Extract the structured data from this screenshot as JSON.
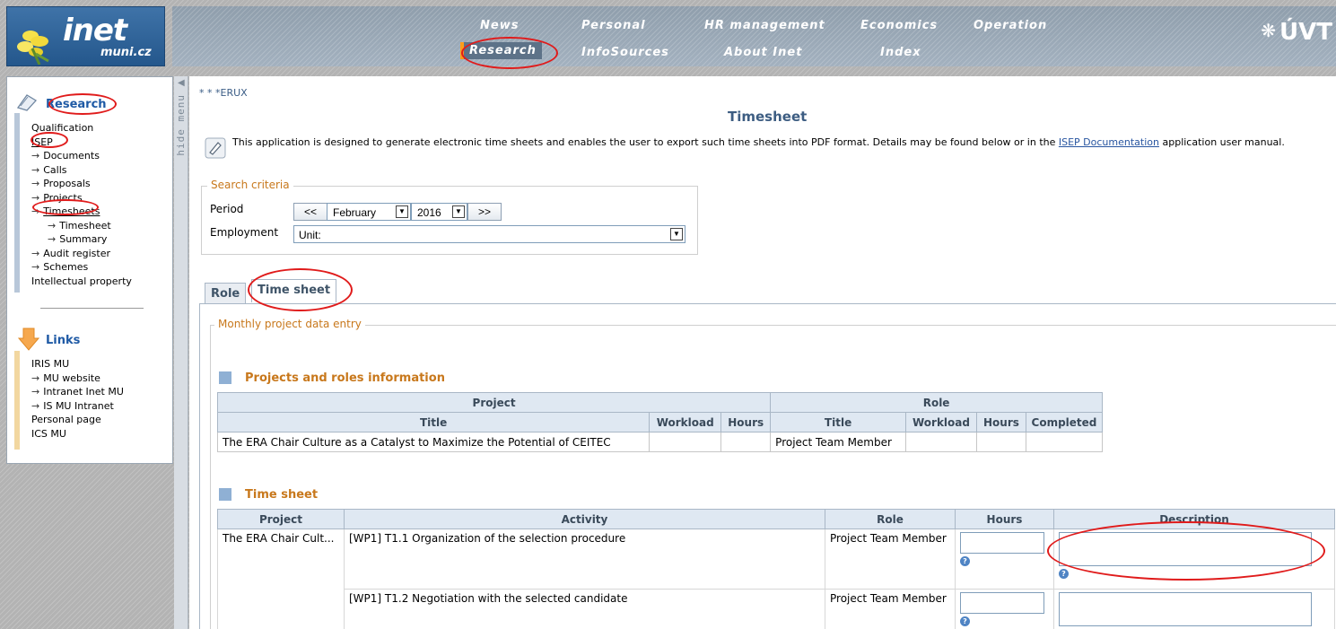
{
  "logo": {
    "main": "inet",
    "sub": "muni.cz"
  },
  "nav": {
    "row1": [
      "News",
      "Personal",
      "HR management",
      "Economics",
      "Operation"
    ],
    "row2": [
      "Research",
      "InfoSources",
      "About Inet",
      "Index"
    ],
    "brand": "ÚVT"
  },
  "sidebar": {
    "section_title": "Research",
    "items": [
      {
        "label": "Qualification",
        "level": 0
      },
      {
        "label": "ISEP",
        "level": 0
      },
      {
        "label": "Documents",
        "level": 1
      },
      {
        "label": "Calls",
        "level": 1
      },
      {
        "label": "Proposals",
        "level": 1
      },
      {
        "label": "Projects",
        "level": 1
      },
      {
        "label": "Timesheets",
        "level": 1
      },
      {
        "label": "Timesheet",
        "level": 2
      },
      {
        "label": "Summary",
        "level": 2
      },
      {
        "label": "Audit register",
        "level": 1
      },
      {
        "label": "Schemes",
        "level": 1
      },
      {
        "label": "Intellectual property",
        "level": 0
      }
    ],
    "links_title": "Links",
    "links": [
      {
        "label": "IRIS MU",
        "level": 0
      },
      {
        "label": "MU website",
        "level": 1
      },
      {
        "label": "Intranet Inet MU",
        "level": 1
      },
      {
        "label": "IS MU Intranet",
        "level": 1
      },
      {
        "label": "Personal page",
        "level": 0
      },
      {
        "label": "ICS MU",
        "level": 0
      }
    ],
    "hide_menu": "hide menu"
  },
  "main": {
    "breadcrumb": "* * *ERUX",
    "title": "Timesheet",
    "intro_text": "This application is designed to generate electronic time sheets and enables the user to export such time sheets into PDF format. Details may be found below or in the",
    "intro_link": "ISEP Documentation",
    "intro_suffix": "application user manual.",
    "search": {
      "legend": "Search criteria",
      "period_label": "Period",
      "prev_btn": "<<",
      "next_btn": ">>",
      "month": "February",
      "year": "2016",
      "employment_label": "Employment",
      "employment_value": "Unit:"
    },
    "tabs": [
      "Role",
      "Time sheet"
    ],
    "monthly_legend": "Monthly project data entry",
    "projects_section": {
      "title": "Projects and roles information",
      "group_headers": [
        "Project",
        "Role"
      ],
      "columns": [
        "Title",
        "Workload",
        "Hours",
        "Title",
        "Workload",
        "Hours",
        "Completed"
      ],
      "rows": [
        [
          "The ERA Chair Culture as a Catalyst to Maximize the Potential of CEITEC",
          "",
          "",
          "Project Team Member",
          "",
          "",
          ""
        ]
      ]
    },
    "timesheet_section": {
      "title": "Time sheet",
      "columns": [
        "Project",
        "Activity",
        "Role",
        "Hours",
        "Description"
      ],
      "project_cell": "The ERA Chair Cult...",
      "rows": [
        {
          "activity": "[WP1] T1.1 Organization of the selection procedure",
          "role": "Project Team Member"
        },
        {
          "activity": "[WP1] T1.2 Negotiation with the selected candidate",
          "role": "Project Team Member"
        }
      ]
    }
  }
}
